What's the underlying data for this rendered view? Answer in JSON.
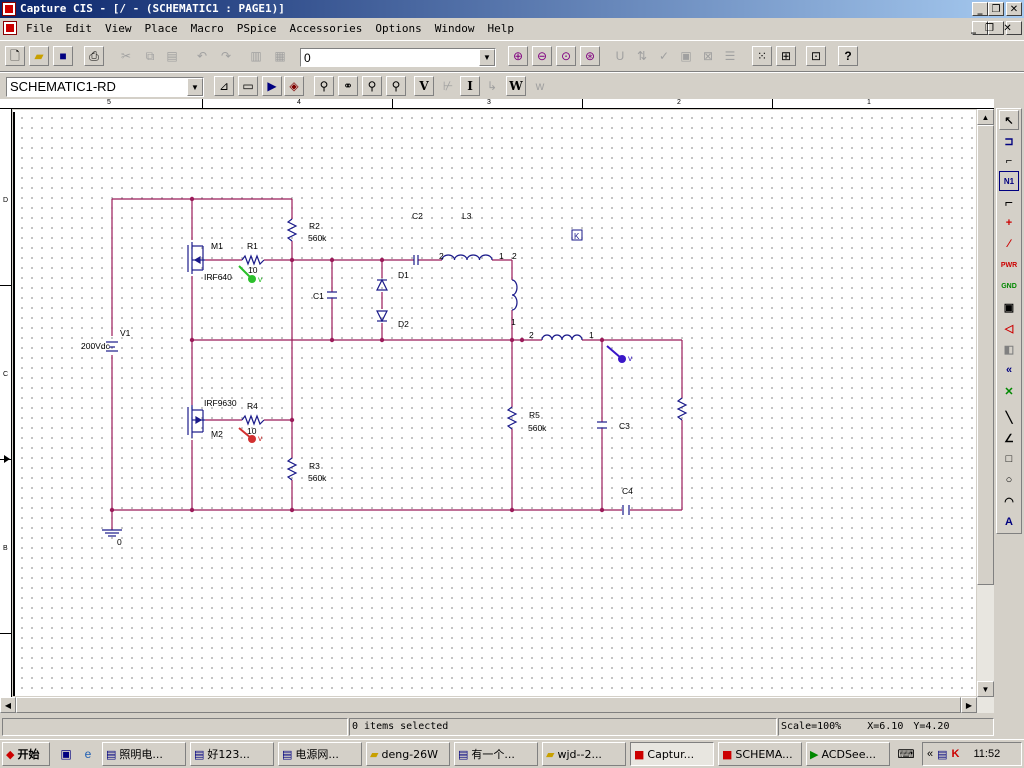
{
  "window": {
    "title": "Capture CIS - [/ - (SCHEMATIC1 : PAGE1)]",
    "controls": {
      "minimize": "_",
      "restore": "❐",
      "close": "✕"
    }
  },
  "menu": [
    "File",
    "Edit",
    "View",
    "Place",
    "Macro",
    "PSpice",
    "Accessories",
    "Options",
    "Window",
    "Help"
  ],
  "toolbar": {
    "part_combo": "0"
  },
  "toolbar2": {
    "schematic_combo": "SCHEMATIC1-RD",
    "tool_labels": [
      "V",
      "I",
      "W"
    ]
  },
  "ruler": {
    "top": [
      "5",
      "4",
      "3",
      "2",
      "1"
    ],
    "left": [
      "D",
      "C",
      "B"
    ]
  },
  "schematic": {
    "wire_color": "#9b1c5b",
    "labels": {
      "v1": "V1",
      "v1_val": "200Vdc",
      "m1": "M1",
      "m1_part": "IRF640",
      "m2": "M2",
      "m2_part": "IRF9630",
      "r1": "R1",
      "r1_val": "10",
      "r2": "R2",
      "r2_val": "560k",
      "r3": "R3",
      "r3_val": "560k",
      "r4": "R4",
      "r4_val": "10",
      "r5": "R5",
      "r5_val": "560k",
      "c1": "C1",
      "c2": "C2",
      "c3": "C3",
      "c4": "C4",
      "l3": "L3",
      "d1": "D1",
      "d2": "D2",
      "gnd": "0",
      "probe": "v",
      "pin1": "1",
      "pin2": "2"
    },
    "probes": [
      {
        "name": "probe-green",
        "color": "#2bbf2b"
      },
      {
        "name": "probe-red",
        "color": "#d23030"
      },
      {
        "name": "probe-blue",
        "color": "#3a17c8"
      }
    ]
  },
  "status": {
    "selection": "0 items selected",
    "scale": "Scale=100%",
    "x": "X=6.10",
    "y": "Y=4.20"
  },
  "taskbar": {
    "start": "开始",
    "items": [
      "照明电...",
      "好123...",
      "电源网...",
      "deng-26W",
      "有一个...",
      "wjd--2...",
      "Captur...",
      "SCHEMA...",
      "ACDSee..."
    ],
    "clock": "11:52"
  }
}
